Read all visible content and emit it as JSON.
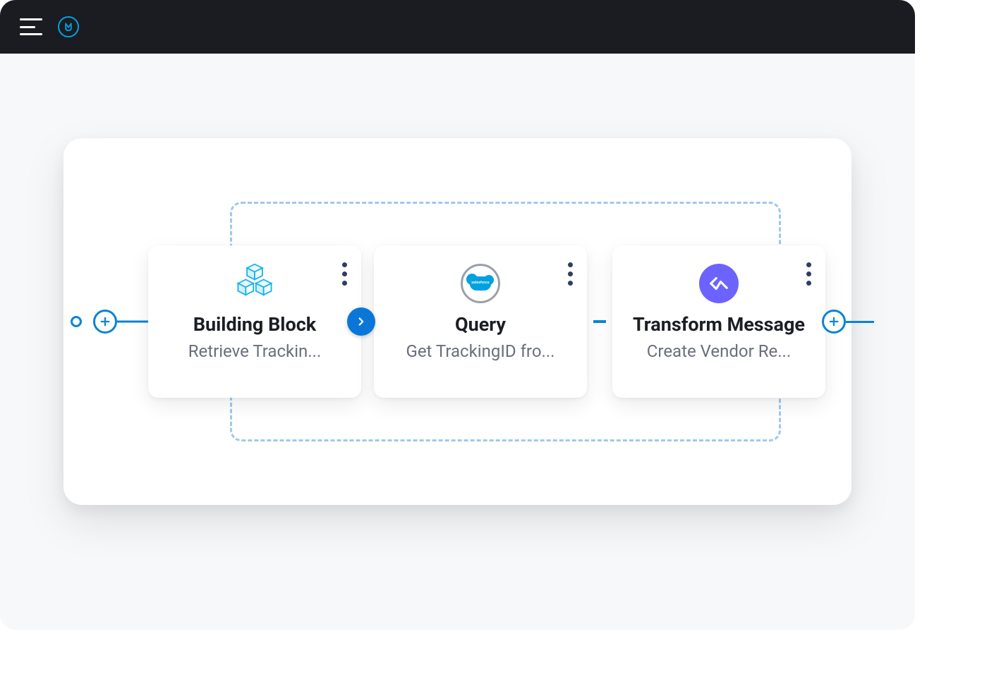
{
  "header": {
    "logo_label": "M"
  },
  "flow": {
    "cards": [
      {
        "id": "building-block",
        "title": "Building Block",
        "subtitle": "Retrieve Trackin...",
        "icon": "cubes-icon",
        "has_expand_badge": true
      },
      {
        "id": "query",
        "title": "Query",
        "subtitle": "Get TrackingID fro...",
        "icon": "salesforce-icon",
        "has_expand_badge": false
      },
      {
        "id": "transform-message",
        "title": "Transform Message",
        "subtitle": "Create Vendor Re...",
        "icon": "transform-icon",
        "has_expand_badge": false
      }
    ]
  },
  "colors": {
    "accent_blue": "#0a84d6",
    "dark_bg": "#1a1c21",
    "cyan_brand": "#00a2df",
    "purple_accent": "#6c63ff"
  }
}
